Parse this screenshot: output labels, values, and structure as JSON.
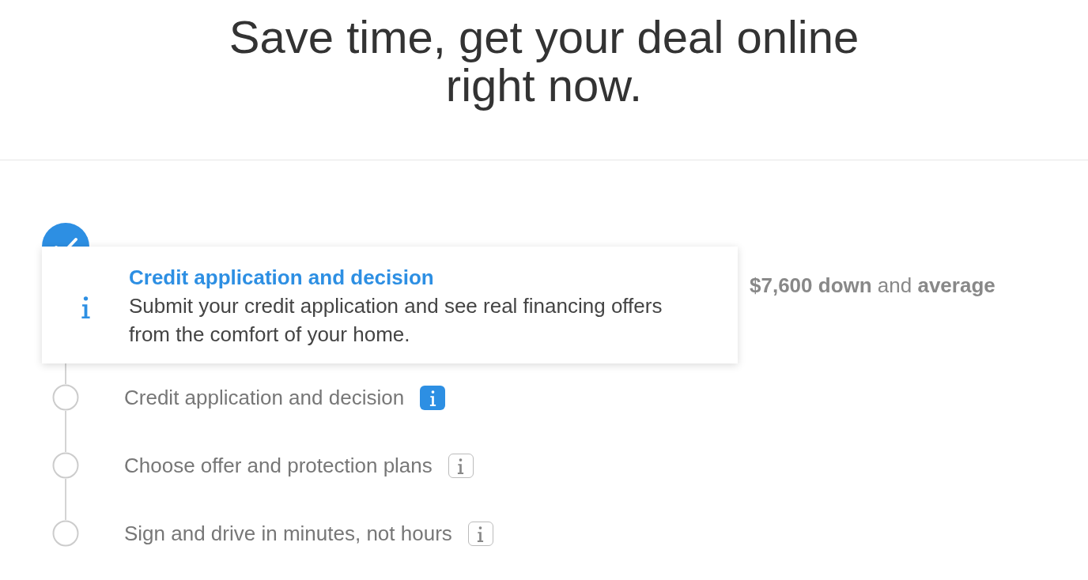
{
  "heading": "Save time, get your deal online right now.",
  "steps": [
    {
      "description": "**$7,600 down** and **average**",
      "completed": true
    },
    {
      "title": "Credit application and decision",
      "completed": false,
      "info_selected": true
    },
    {
      "title": "Choose offer and protection plans",
      "completed": false,
      "info_selected": false
    },
    {
      "title": "Sign and drive in minutes, not hours",
      "completed": false,
      "info_selected": false
    }
  ],
  "tooltip": {
    "title": "Credit application and decision",
    "body": "Submit your credit application and see real financing offers from the comfort of your home."
  }
}
